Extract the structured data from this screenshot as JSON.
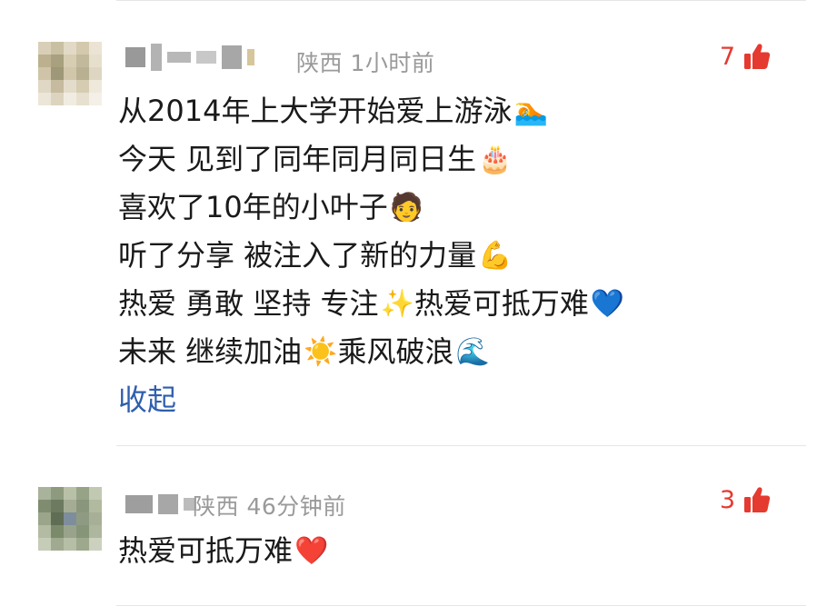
{
  "comments": [
    {
      "location": "陕西",
      "time": "1小时前",
      "likes": "7",
      "lines": [
        {
          "text": "从2014年上大学开始爱上游泳",
          "emoji": "🏊"
        },
        {
          "text": "今天 见到了同年同月同日生",
          "emoji": "🎂"
        },
        {
          "text": "喜欢了10年的小叶子",
          "emoji": "🧑"
        },
        {
          "text": "听了分享 被注入了新的力量",
          "emoji": "💪"
        },
        {
          "text": "热爱 勇敢 坚持 专注",
          "emoji": "✨",
          "text2": "热爱可抵万难",
          "emoji2": "💙"
        },
        {
          "text": "未来 继续加油",
          "emoji": "☀️",
          "text2": "乘风破浪",
          "emoji2": "🌊"
        }
      ],
      "collapse_label": "收起"
    },
    {
      "location": "陕西",
      "time": "46分钟前",
      "likes": "3",
      "lines": [
        {
          "text": "热爱可抵万难",
          "emoji": "❤️"
        }
      ]
    }
  ],
  "colors": {
    "like_red": "#e53a2f",
    "link_blue": "#2e5fae",
    "meta_gray": "#9a9a9a"
  },
  "icons": {
    "like": "thumbs-up-icon"
  }
}
